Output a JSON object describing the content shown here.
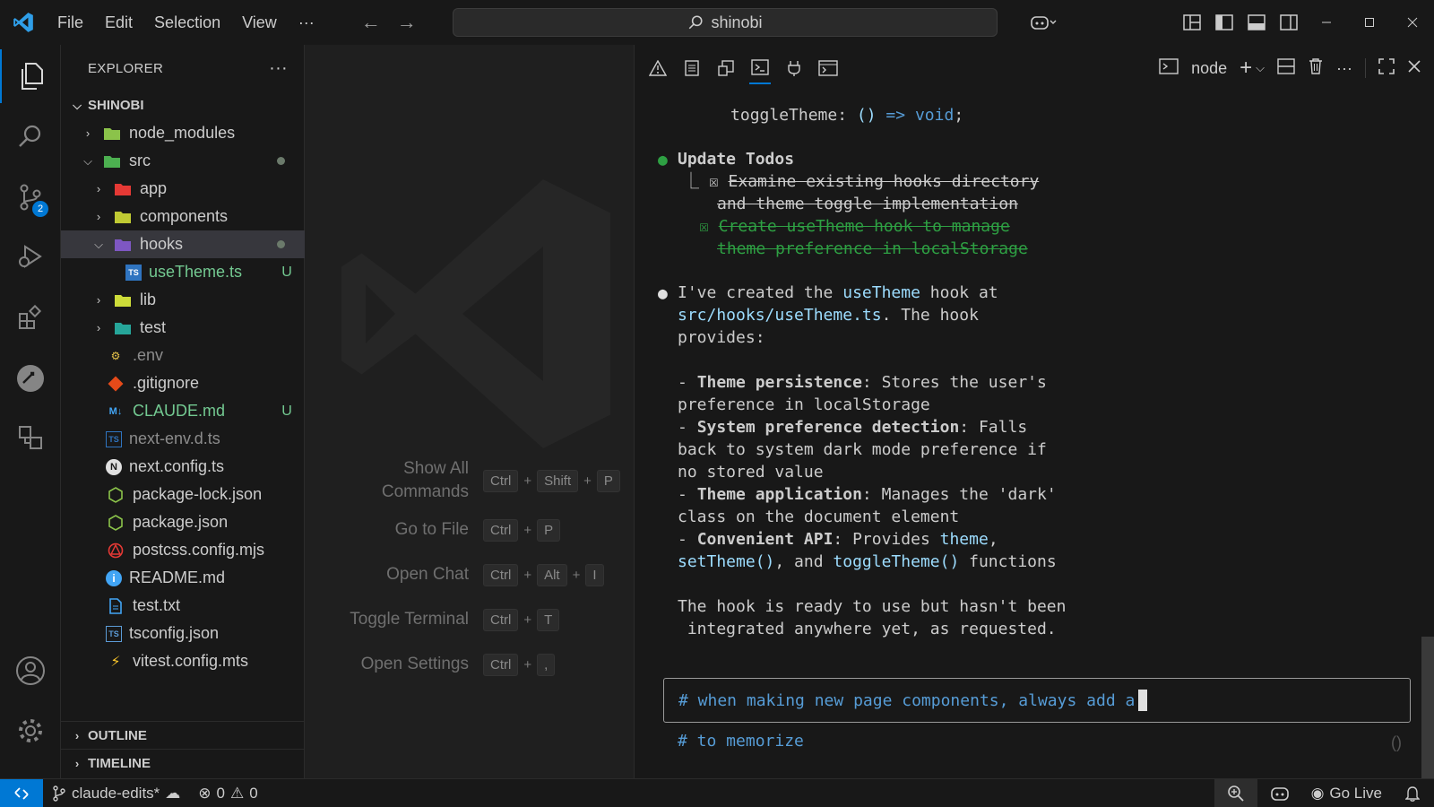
{
  "titlebar": {
    "menu": [
      "File",
      "Edit",
      "Selection",
      "View",
      "···"
    ],
    "search_text": "shinobi"
  },
  "activity": {
    "source_control_badge": "2"
  },
  "explorer": {
    "title": "EXPLORER",
    "more": "···",
    "root": "SHINOBI",
    "items": [
      {
        "name": "node_modules",
        "tag": ""
      },
      {
        "name": "src",
        "tag": ""
      },
      {
        "name": "app",
        "tag": ""
      },
      {
        "name": "components",
        "tag": ""
      },
      {
        "name": "hooks",
        "tag": ""
      },
      {
        "name": "useTheme.ts",
        "tag": "U"
      },
      {
        "name": "lib",
        "tag": ""
      },
      {
        "name": "test",
        "tag": ""
      },
      {
        "name": ".env",
        "tag": ""
      },
      {
        "name": ".gitignore",
        "tag": ""
      },
      {
        "name": "CLAUDE.md",
        "tag": "U"
      },
      {
        "name": "next-env.d.ts",
        "tag": ""
      },
      {
        "name": "next.config.ts",
        "tag": ""
      },
      {
        "name": "package-lock.json",
        "tag": ""
      },
      {
        "name": "package.json",
        "tag": ""
      },
      {
        "name": "postcss.config.mjs",
        "tag": ""
      },
      {
        "name": "README.md",
        "tag": ""
      },
      {
        "name": "test.txt",
        "tag": ""
      },
      {
        "name": "tsconfig.json",
        "tag": ""
      },
      {
        "name": "vitest.config.mts",
        "tag": ""
      }
    ],
    "outline": "OUTLINE",
    "timeline": "TIMELINE"
  },
  "shortcuts": {
    "show_all_1": "Show All",
    "show_all_2": "Commands",
    "go_to_file": "Go to File",
    "open_chat": "Open Chat",
    "toggle_terminal": "Toggle Terminal",
    "open_settings": "Open Settings",
    "keys": {
      "ctrl": "Ctrl",
      "shift": "Shift",
      "alt": "Alt",
      "p": "P",
      "i": "I",
      "t": "T",
      "comma": ","
    },
    "plus": "+"
  },
  "panel": {
    "terminal_name": "node",
    "lines": {
      "l0_a": "      toggleTheme: ",
      "l0_b": "()",
      "l0_c": " => ",
      "l0_d": "void",
      "l0_e": ";",
      "todos_bullet": "●",
      "todos_title": "Update Todos",
      "todo1_prefix": "⎿ ☒ ",
      "todo1_a": "Examine existing hooks directory",
      "todo1_b": "and theme toggle implementation",
      "todo2_prefix": "☒ ",
      "todo2_a": "Create useTheme hook to manage",
      "todo2_b": "theme preference in localStorage",
      "msg_bullet": "●",
      "msg1_a": "I've created the ",
      "msg1_b": "useTheme",
      "msg1_c": " hook at",
      "msg2_a": "src/hooks/useTheme.ts",
      "msg2_b": ". The hook",
      "msg3": "provides:",
      "p1_dash": "- ",
      "p1_bold": "Theme persistence",
      "p1_rest": ": Stores the user's",
      "p1_2": "preference in localStorage",
      "p2_bold": "System preference detection",
      "p2_rest": ": Falls",
      "p2_2": "back to system dark mode preference if",
      "p2_3": "no stored value",
      "p3_bold": "Theme application",
      "p3_rest": ": Manages the 'dark'",
      "p3_2": "class on the document element",
      "p4_bold": "Convenient API",
      "p4_rest": ": Provides ",
      "p4_theme": "theme",
      "p4_comma": ",",
      "p4_2a": "setTheme()",
      "p4_2b": ", and ",
      "p4_2c": "toggleTheme()",
      "p4_2d": " functions",
      "end1": "The hook is ready to use but hasn't been",
      "end2": " integrated anywhere yet, as requested."
    },
    "input_text": "# when making new page components, always add a",
    "memorize_hint": "# to memorize"
  },
  "status": {
    "branch": "claude-edits*",
    "errors": "0",
    "warnings": "0",
    "go_live": "Go Live"
  }
}
